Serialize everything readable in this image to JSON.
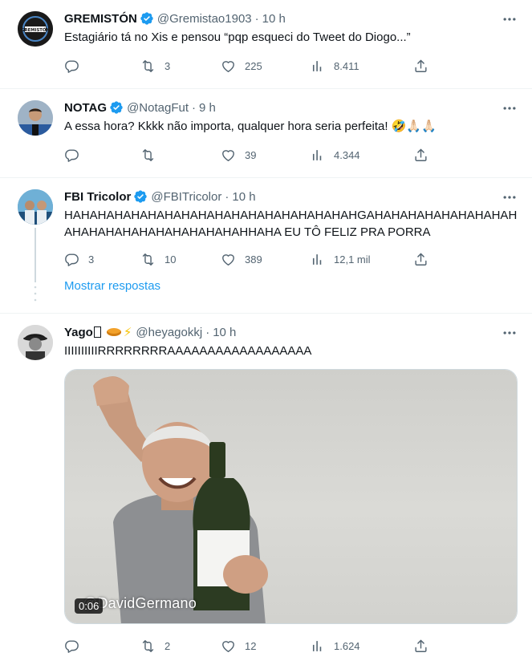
{
  "colors": {
    "accent": "#1d9bf0",
    "muted": "#536471",
    "text": "#0f1419",
    "divider": "#eff3f4"
  },
  "tweets": [
    {
      "author": "GREMISTÓN",
      "handle": "@Gremistao1903",
      "time": "10 h",
      "text": "Estagiário tá no Xis e pensou “pqp esqueci do Tweet do Diogo...”",
      "replies": "",
      "retweets": "3",
      "likes": "225",
      "views": "8.411",
      "avatar_text": "GREMISTÓN"
    },
    {
      "author": "NOTAG",
      "handle": "@NotagFut",
      "time": "9 h",
      "text": "A essa hora? Kkkk não importa, qualquer hora seria perfeita! 🤣🙏🏻🙏🏻",
      "replies": "",
      "retweets": "",
      "likes": "39",
      "views": "4.344"
    },
    {
      "author": "FBI Tricolor",
      "handle": "@FBITricolor",
      "time": "10 h",
      "text": "HAHAHAHAHAHAHAHAHAHAHAHAHAHAHAHAHAHGAHAHAHAHAHAHAHAHAHAHAHAHAHAHAHAHAHAHAHAHHAHA EU TÔ FELIZ PRA PORRA",
      "replies": "3",
      "retweets": "10",
      "likes": "389",
      "views": "12,1 mil",
      "show_replies": "Mostrar respostas"
    },
    {
      "author": "Yago",
      "handle": "@heyagokkj",
      "time": "10 h",
      "text": "IIIIIIIIIIRRRRRRRRAAAAAAAAAAAAAAAAAA",
      "replies": "",
      "retweets": "2",
      "likes": "12",
      "views": "1.624",
      "video_duration": "0:06",
      "video_watermark": "@DavidGermano"
    }
  ],
  "icons": [
    "verified-icon",
    "more-icon",
    "reply-icon",
    "retweet-icon",
    "like-icon",
    "views-icon",
    "share-icon"
  ]
}
